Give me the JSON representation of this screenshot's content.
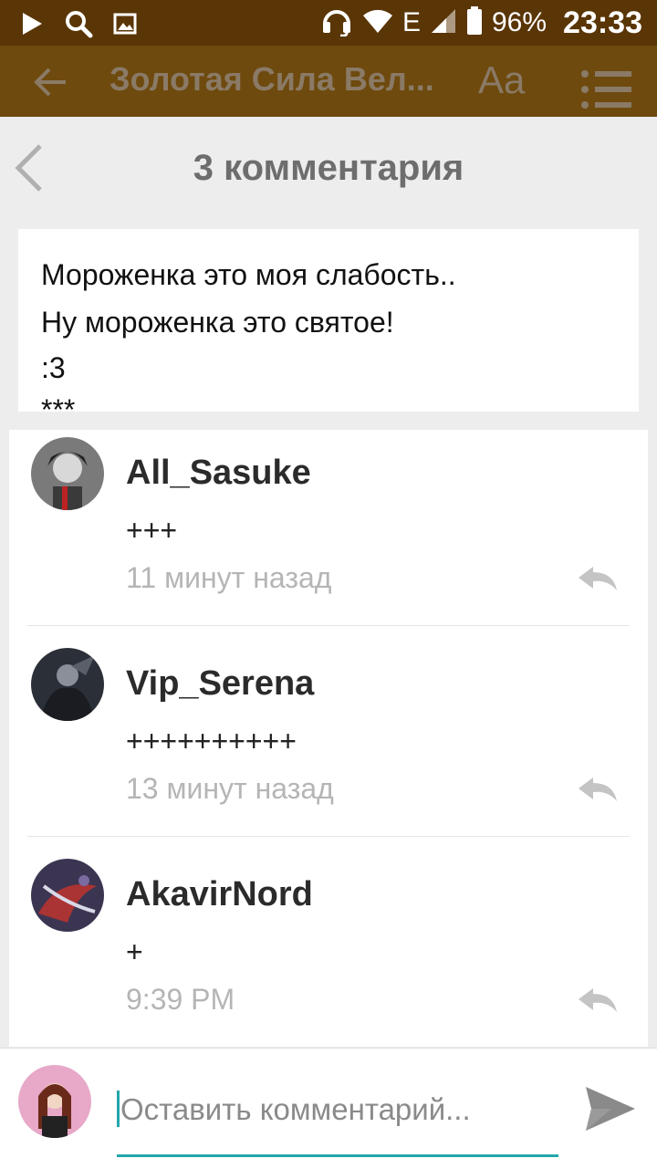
{
  "status_bar": {
    "battery_percent": "96%",
    "time": "23:33",
    "network": "E"
  },
  "app_bar": {
    "title": "Золотая Сила Вел...",
    "font_button": "Aa"
  },
  "comments_sheet": {
    "title": "3 комментария",
    "excerpt_lines": [
      "Мороженка это моя слабость..",
      "Ну мороженка это святое!",
      ":3",
      "***"
    ],
    "comments": [
      {
        "author": "All_Sasuke",
        "text": "+++",
        "time": "11 минут назад",
        "avatar_color": "#6d6d6d"
      },
      {
        "author": "Vip_Serena",
        "text": "++++++++++",
        "time": "13 минут назад",
        "avatar_color": "#3a3f4a"
      },
      {
        "author": "AkavirNord",
        "text": "+",
        "time": "9:39 PM",
        "avatar_color": "#4a3a5a"
      }
    ]
  },
  "composer": {
    "placeholder": "Оставить комментарий..."
  },
  "colors": {
    "status_bar": "#5a3506",
    "app_bar": "#6e4a0e",
    "accent": "#22a7ab",
    "timestamp": "#b5b5b5"
  }
}
